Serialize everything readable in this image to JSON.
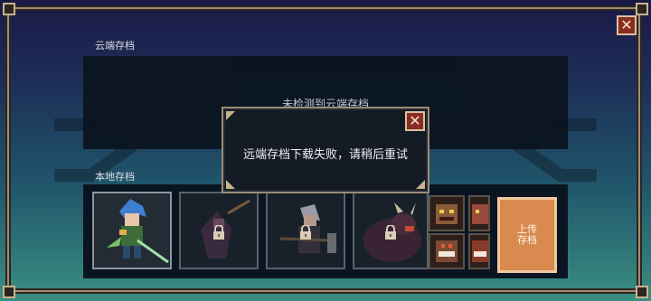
{
  "window": {
    "close_icon": "close-icon"
  },
  "cloud_save": {
    "label": "云端存档",
    "empty_text": "未检测到云端存档"
  },
  "local_save": {
    "label": "本地存档",
    "slots": [
      {
        "hero": "blue-haired-swordsman",
        "locked": false
      },
      {
        "hero": "hooded-mage",
        "locked": true
      },
      {
        "hero": "grey-haired-warrior",
        "locked": true
      },
      {
        "hero": "horned-beast",
        "locked": true
      }
    ],
    "upload_label": "上传存档"
  },
  "dialog": {
    "message": "远端存档下载失败，请稍后重试",
    "close_icon": "close-icon"
  }
}
